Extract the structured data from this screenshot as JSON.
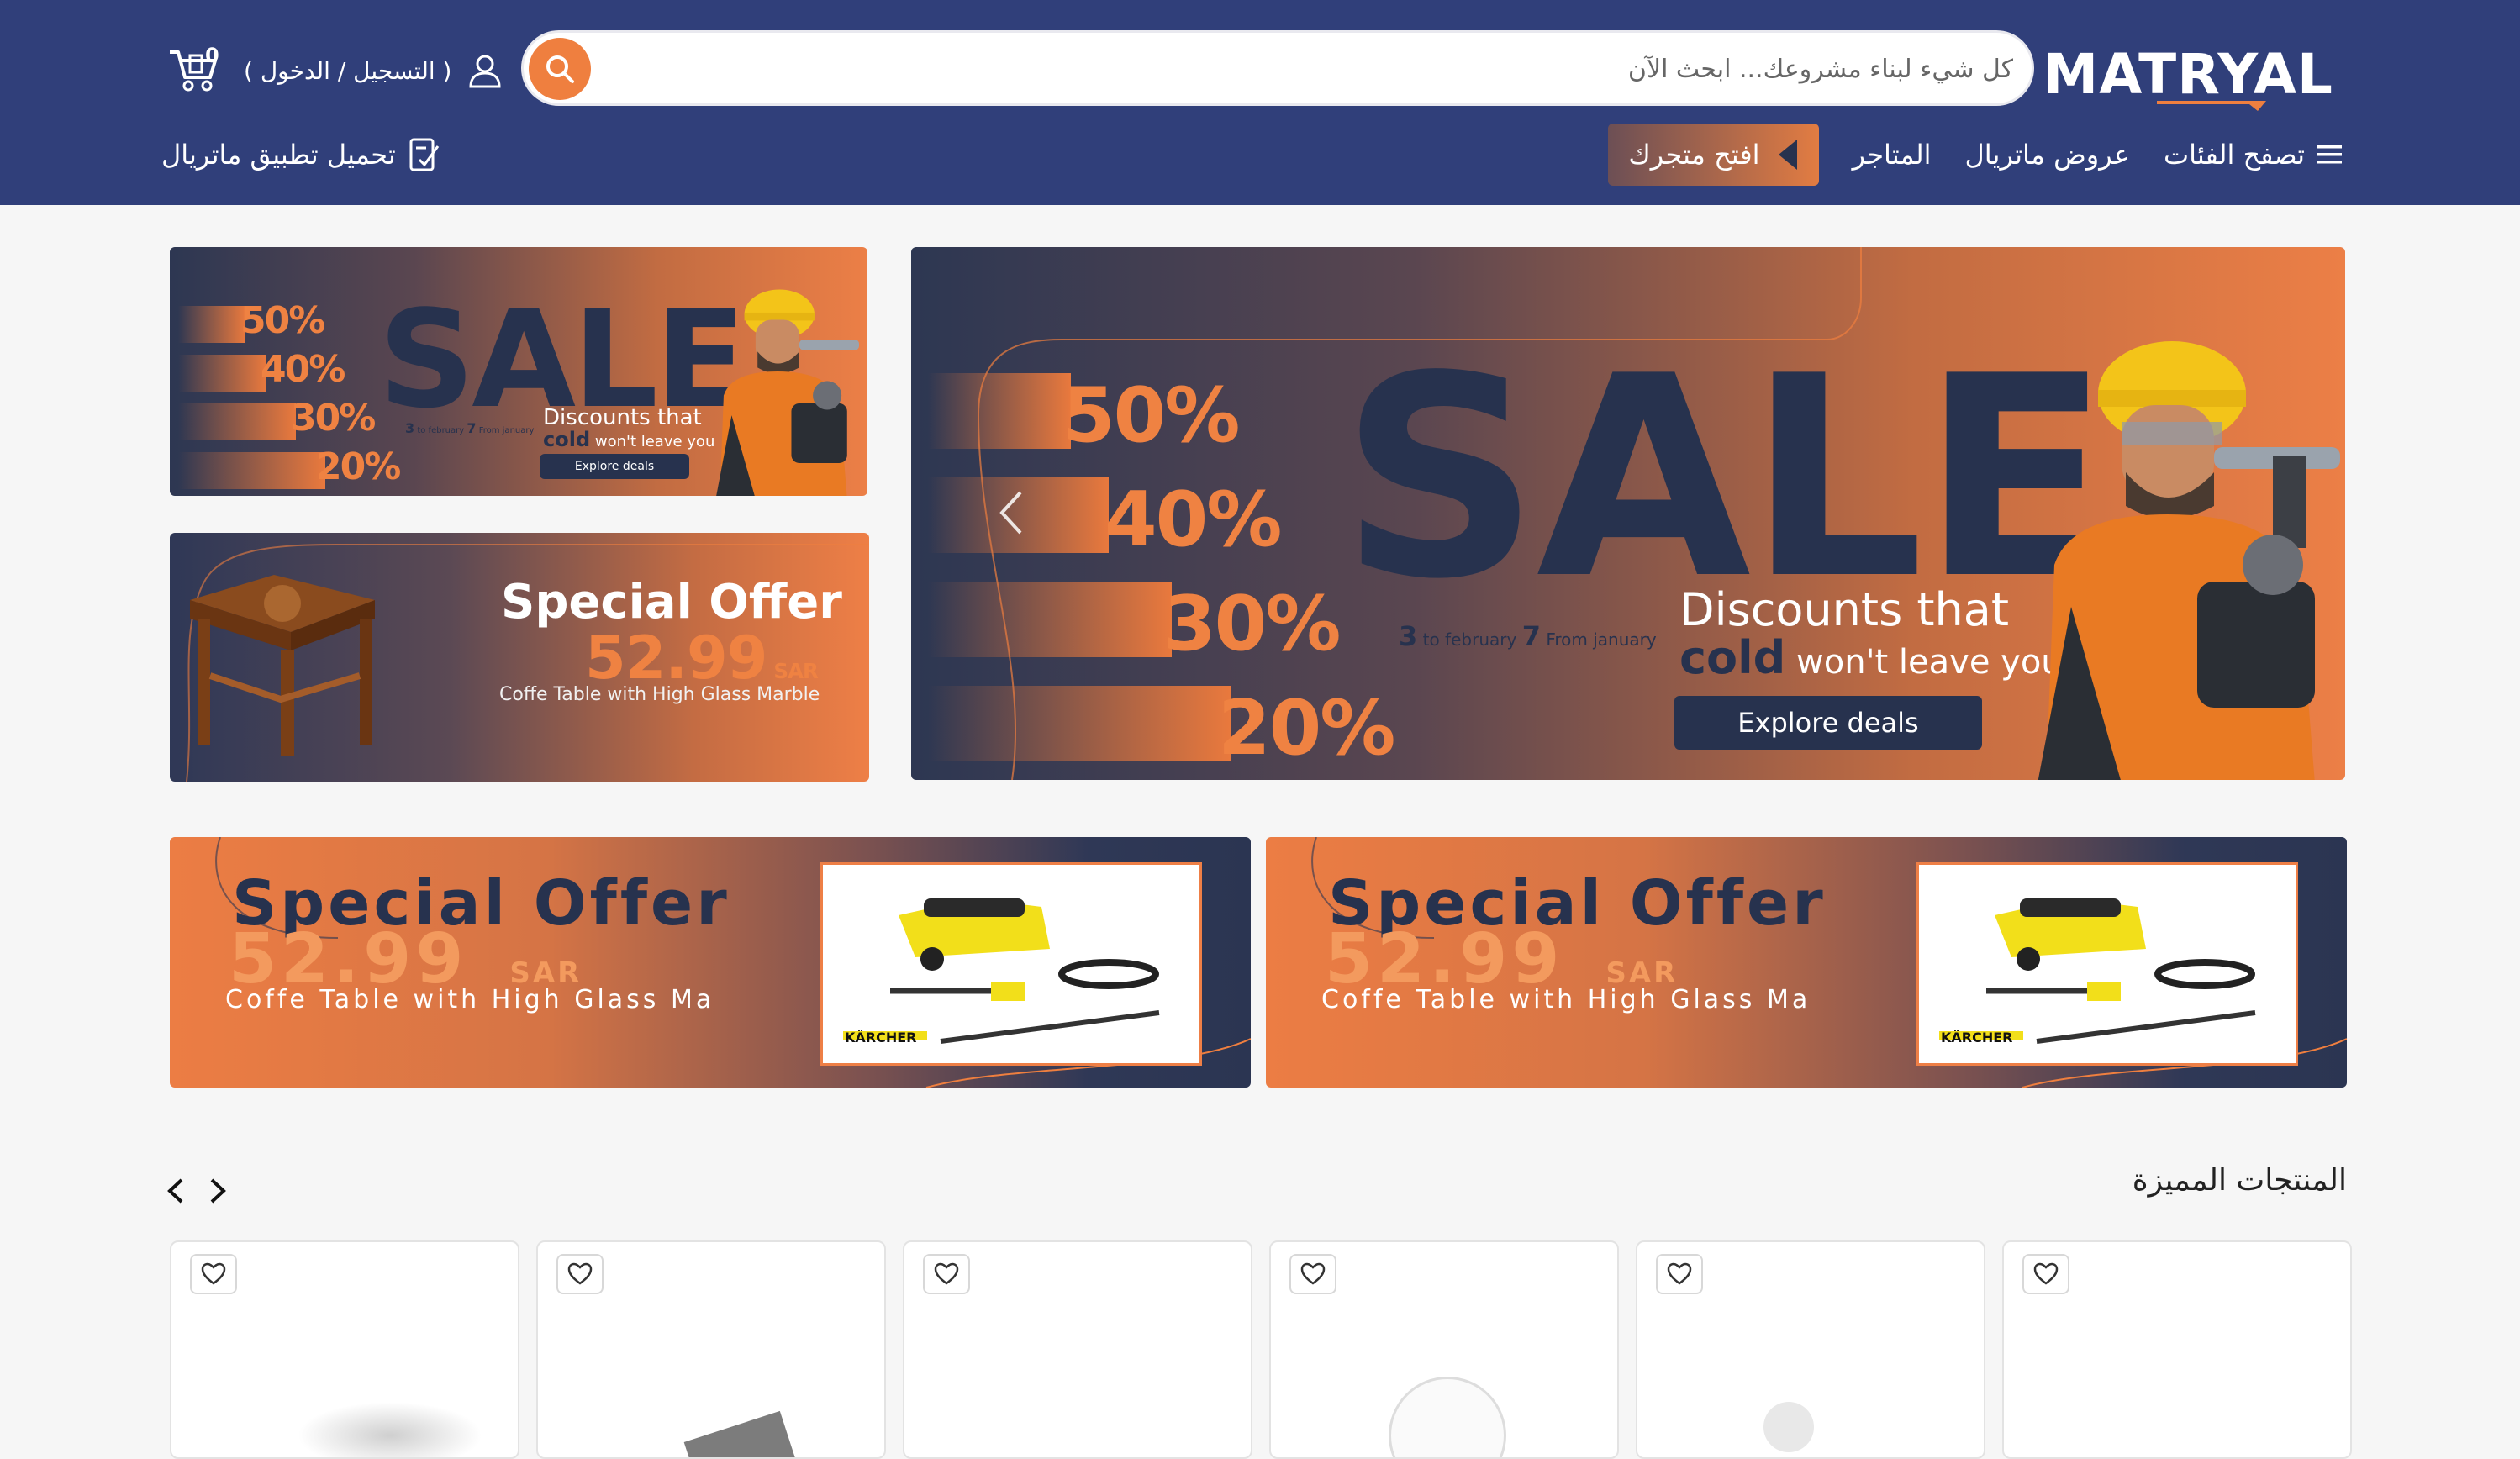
{
  "header": {
    "logo_text": "MATRYAL",
    "search": {
      "placeholder": "كل شيء لبناء مشروعك... ابحث الآن"
    },
    "auth_label": "( التسجيل / الدخول )",
    "cart_count": "0",
    "nav": {
      "browse_categories": "تصفح الفئات",
      "matryal_offers": "عروض ماتريال",
      "stores": "المتاجر",
      "open_store": "افتح متجرك"
    },
    "download_app": "تحميل تطبيق ماتريال"
  },
  "hero": {
    "sale_word": "SALE",
    "percents": [
      "50%",
      "40%",
      "30%",
      "20%"
    ],
    "tagline_line1": "Discounts that",
    "cold_word": "cold",
    "tagline_line2": "won't leave you",
    "explore_label": "Explore deals",
    "date_start": "3",
    "date_start_text": "to february",
    "date_end": "7",
    "date_end_text": "From january"
  },
  "side_sale": {
    "sale_word": "SALE",
    "percents": [
      "50%",
      "40%",
      "30%",
      "20%"
    ],
    "tagline_line1": "Discounts that",
    "cold_word": "cold",
    "tagline_line2": "won't leave you",
    "explore_label": "Explore deals",
    "date_start": "3",
    "date_start_text": "to february",
    "date_end": "7",
    "date_end_text": "From january"
  },
  "side_offer": {
    "title": "Special Offer",
    "price": "52.99",
    "currency": "SAR",
    "description": "Coffe Table with High Glass Marble"
  },
  "wide_offers": [
    {
      "title": "Special Offer",
      "price": "52.99",
      "currency": "SAR",
      "description": "Coffe Table with High Glass Ma",
      "brand": "KÄRCHER"
    },
    {
      "title": "Special Offer",
      "price": "52.99",
      "currency": "SAR",
      "description": "Coffe Table with High Glass Ma",
      "brand": "KÄRCHER"
    }
  ],
  "featured": {
    "title": "المنتجات المميزة",
    "card_count_visible": 6
  },
  "colors": {
    "header_bg": "#303f7a",
    "accent_orange": "#ef7f3f",
    "navy": "#27324e"
  }
}
